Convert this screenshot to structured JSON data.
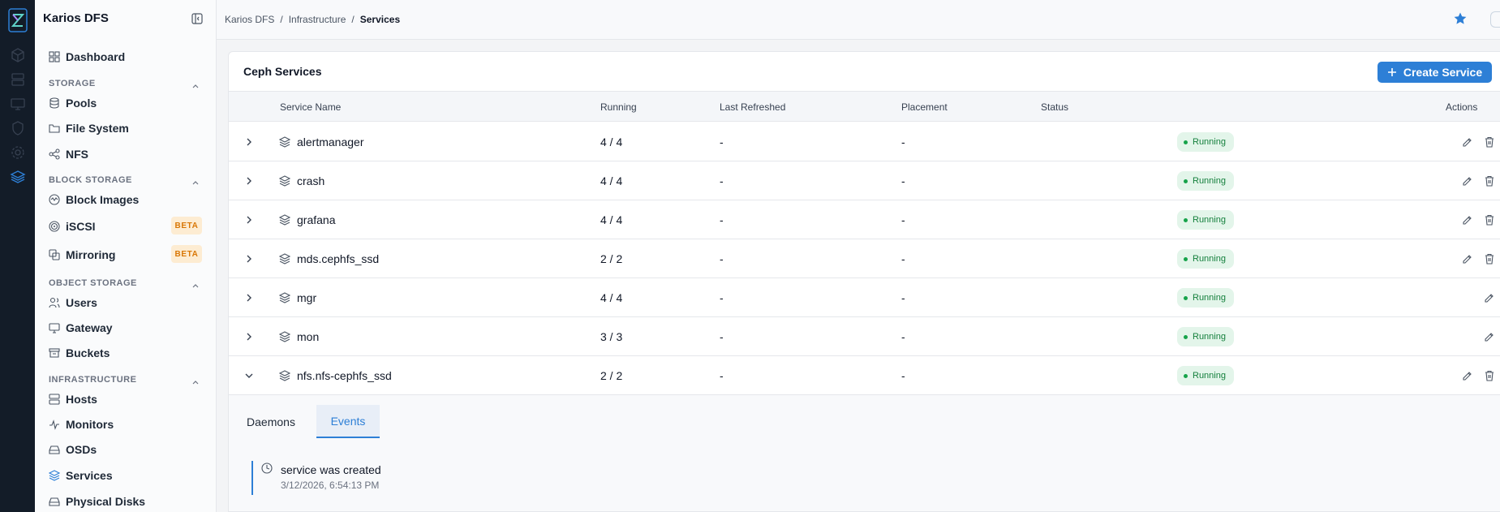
{
  "app": {
    "title": "Karios DFS"
  },
  "rail": {
    "icons": [
      "logo-icon",
      "cube-icon",
      "server-icon",
      "monitor-icon",
      "shield-icon",
      "gear-icon",
      "layers-icon"
    ]
  },
  "sidebar": {
    "dashboard": "Dashboard",
    "sections": [
      {
        "label": "STORAGE",
        "items": [
          "Pools",
          "File System",
          "NFS"
        ]
      },
      {
        "label": "BLOCK STORAGE",
        "items": [
          "Block Images",
          "iSCSI",
          "Mirroring"
        ]
      },
      {
        "label": "OBJECT STORAGE",
        "items": [
          "Users",
          "Gateway",
          "Buckets"
        ]
      },
      {
        "label": "INFRASTRUCTURE",
        "items": [
          "Hosts",
          "Monitors",
          "OSDs",
          "Services",
          "Physical Disks"
        ]
      }
    ],
    "beta": "BETA"
  },
  "breadcrumb": {
    "root": "Karios DFS",
    "sep": "/",
    "parent": "Infrastructure",
    "current": "Services"
  },
  "card": {
    "title": "Ceph Services",
    "create_label": "Create Service"
  },
  "table": {
    "headers": {
      "name": "Service Name",
      "running": "Running",
      "refreshed": "Last Refreshed",
      "placement": "Placement",
      "status": "Status",
      "actions": "Actions"
    },
    "rows": [
      {
        "name": "alertmanager",
        "running": "4 / 4",
        "refreshed": "-",
        "placement": "-",
        "status": "Running"
      },
      {
        "name": "crash",
        "running": "4 / 4",
        "refreshed": "-",
        "placement": "-",
        "status": "Running"
      },
      {
        "name": "grafana",
        "running": "4 / 4",
        "refreshed": "-",
        "placement": "-",
        "status": "Running"
      },
      {
        "name": "mds.cephfs_ssd",
        "running": "2 / 2",
        "refreshed": "-",
        "placement": "-",
        "status": "Running"
      },
      {
        "name": "mgr",
        "running": "4 / 4",
        "refreshed": "-",
        "placement": "-",
        "status": "Running"
      },
      {
        "name": "mon",
        "running": "3 / 3",
        "refreshed": "-",
        "placement": "-",
        "status": "Running"
      },
      {
        "name": "nfs.nfs-cephfs_ssd",
        "running": "2 / 2",
        "refreshed": "-",
        "placement": "-",
        "status": "Running"
      }
    ]
  },
  "detail": {
    "tabs": {
      "daemons": "Daemons",
      "events": "Events"
    },
    "event": {
      "message": "service was created",
      "timestamp": "3/12/2026, 6:54:13 PM"
    }
  },
  "colors": {
    "accent": "#2d7fd6",
    "rail": "#131c28",
    "running_bg": "#e3f5ea",
    "running_fg": "#15803d",
    "beta_bg": "#fdecd2",
    "beta_fg": "#d97706"
  }
}
